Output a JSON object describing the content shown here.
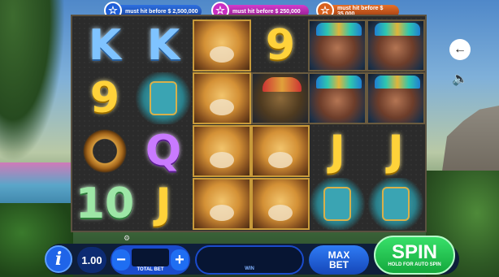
{
  "jackpots": [
    {
      "color": "#2d6fe0",
      "label": "must hit before $ 2,500,000"
    },
    {
      "color": "#d43ccc",
      "label": "must hit before $ 250,000"
    },
    {
      "color": "#e6702a",
      "label": "must hit before $ 35,000"
    }
  ],
  "reels": [
    {
      "symbols": [
        "K",
        "9",
        "serpent",
        "10"
      ]
    },
    {
      "symbols": [
        "K",
        "mask",
        "Q",
        "J"
      ]
    },
    {
      "symbols": [
        "jaguar",
        "jaguar",
        "jaguar",
        "jaguar"
      ]
    },
    {
      "symbols": [
        "9",
        "warrior",
        "jaguar",
        "jaguar"
      ]
    },
    {
      "symbols": [
        "queen",
        "queen",
        "J",
        "mask"
      ]
    },
    {
      "symbols": [
        "queen",
        "queen",
        "J",
        "mask"
      ]
    }
  ],
  "side": {
    "back_icon": "arrow-left-icon",
    "sound_icon": "speaker-icon"
  },
  "controls": {
    "info_label": "i",
    "bet_value": "1.00",
    "minus_label": "−",
    "plus_label": "+",
    "total_bet_label": "TOTAL BET",
    "win_label": "WIN",
    "max_bet_line1": "MAX",
    "max_bet_line2": "BET",
    "spin_label": "SPIN",
    "spin_sub": "HOLD FOR AUTO SPIN"
  }
}
